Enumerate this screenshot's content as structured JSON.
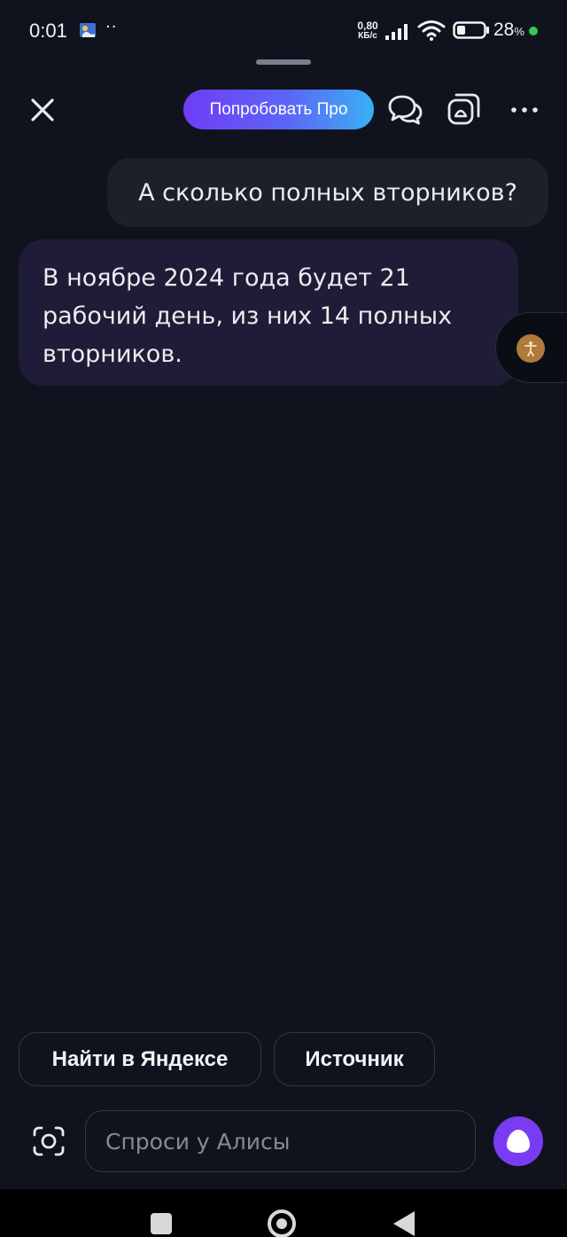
{
  "status_bar": {
    "time": "0:01",
    "extra": "··",
    "net_speed_value": "0,80",
    "net_speed_unit": "КБ/с",
    "battery_value": "28",
    "battery_unit": "%"
  },
  "header": {
    "pro_button_label": "Попробовать Про"
  },
  "messages": [
    {
      "role": "user",
      "text": "А сколько полных вторников?"
    },
    {
      "role": "assistant",
      "text": "В ноябре 2024 года будет 21 рабочий день, из них 14 полных вторников."
    }
  ],
  "suggestions": [
    {
      "label": "Найти в Яндексе"
    },
    {
      "label": "Источник"
    }
  ],
  "input": {
    "placeholder": "Спроси у Алисы",
    "value": ""
  },
  "colors": {
    "background": "#10131d",
    "pro_gradient_start": "#6f3cf5",
    "pro_gradient_end": "#3ab0f3",
    "alice_button": "#7a3cf2",
    "battery_dot": "#34c759"
  },
  "icons": {
    "close": "close-icon",
    "chats": "chat-bubbles-icon",
    "gallery": "gallery-icon",
    "more": "more-dots-icon",
    "camera": "camera-icon",
    "alice": "alice-logo-icon",
    "accessibility": "accessibility-icon"
  }
}
